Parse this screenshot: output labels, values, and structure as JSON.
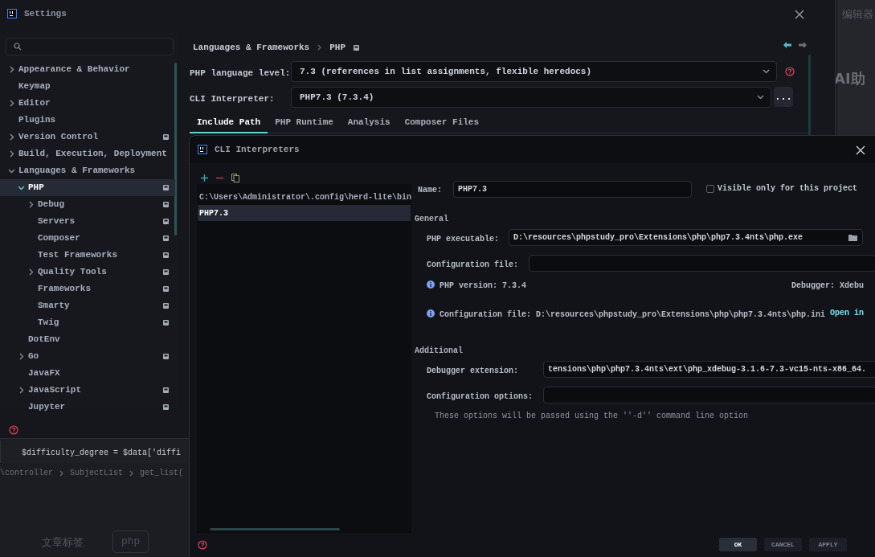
{
  "background": {
    "side_caption": "编辑器",
    "side_heading": "AI助",
    "editor_line": "$difficulty_degree = $data['diffi",
    "breadcrumb": [
      "\\controller",
      "SubjectList",
      "get_list("
    ],
    "tag_label": "文章标签",
    "tag": "php"
  },
  "settings": {
    "title": "Settings",
    "sidebar": {
      "items": [
        {
          "label": "Appearance & Behavior",
          "expanded": false
        },
        {
          "label": "Keymap"
        },
        {
          "label": "Editor",
          "expanded": false
        },
        {
          "label": "Plugins"
        },
        {
          "label": "Version Control",
          "expanded": false,
          "project_scoped": true
        },
        {
          "label": "Build, Execution, Deployment",
          "expanded": false
        },
        {
          "label": "Languages & Frameworks",
          "expanded": true,
          "children": [
            {
              "label": "PHP",
              "expanded": true,
              "selected": true,
              "project_scoped": true,
              "children": [
                {
                  "label": "Debug",
                  "expanded": false,
                  "project_scoped": true
                },
                {
                  "label": "Servers",
                  "project_scoped": true
                },
                {
                  "label": "Composer",
                  "project_scoped": true
                },
                {
                  "label": "Test Frameworks",
                  "project_scoped": true
                },
                {
                  "label": "Quality Tools",
                  "expanded": false,
                  "project_scoped": true
                },
                {
                  "label": "Frameworks",
                  "project_scoped": true
                },
                {
                  "label": "Smarty",
                  "project_scoped": true
                },
                {
                  "label": "Twig",
                  "project_scoped": true
                }
              ]
            },
            {
              "label": "DotEnv"
            },
            {
              "label": "Go",
              "expanded": false,
              "project_scoped": true
            },
            {
              "label": "JavaFX"
            },
            {
              "label": "JavaScript",
              "expanded": false,
              "project_scoped": true
            },
            {
              "label": "Jupyter",
              "project_scoped": true
            }
          ]
        }
      ]
    },
    "breadcrumb": [
      "Languages & Frameworks",
      "PHP"
    ],
    "language_level": {
      "label": "PHP language level:",
      "value": "7.3 (references in list assignments, flexible heredocs)"
    },
    "cli_interpreter": {
      "label": "CLI Interpreter:",
      "value": "PHP7.3 (7.3.4)",
      "more": "..."
    },
    "tabs": [
      {
        "label": "Include Path",
        "selected": true
      },
      {
        "label": "PHP Runtime",
        "selected": false
      },
      {
        "label": "Analysis",
        "selected": false
      },
      {
        "label": "Composer Files",
        "selected": false
      }
    ]
  },
  "cli_dialog": {
    "title": "CLI Interpreters",
    "list": [
      {
        "label": "C:\\Users\\Administrator\\.config\\herd-lite\\bin",
        "selected": false
      },
      {
        "label": "PHP7.3",
        "selected": true
      }
    ],
    "name": {
      "label": "Name:",
      "value": "PHP7.3"
    },
    "visible_only": {
      "label": "Visible only for this project",
      "checked": false
    },
    "general": {
      "title": "General",
      "executable": {
        "label": "PHP executable:",
        "value": "D:\\resources\\phpstudy_pro\\Extensions\\php\\php7.3.4nts\\php.exe"
      },
      "config_file": {
        "label": "Configuration file:"
      },
      "php_version": "PHP version: 7.3.4",
      "debugger": "Debugger: Xdebu",
      "config_info": "Configuration file: D:\\resources\\phpstudy_pro\\Extensions\\php\\php7.3.4nts\\php.ini",
      "open_link": "Open in"
    },
    "additional": {
      "title": "Additional",
      "debugger_extension": {
        "label": "Debugger extension:",
        "value": "tensions\\php\\php7.3.4nts\\ext\\php_xdebug-3.1.6-7.3-vc15-nts-x86_64."
      },
      "config_options": {
        "label": "Configuration options:"
      },
      "hint": "These options will be passed using the ''-d'' command line option"
    },
    "buttons": [
      {
        "label": "OK",
        "kind": "primary"
      },
      {
        "label": "CANCEL",
        "kind": "secondary"
      },
      {
        "label": "APPLY",
        "kind": "secondary"
      }
    ]
  }
}
